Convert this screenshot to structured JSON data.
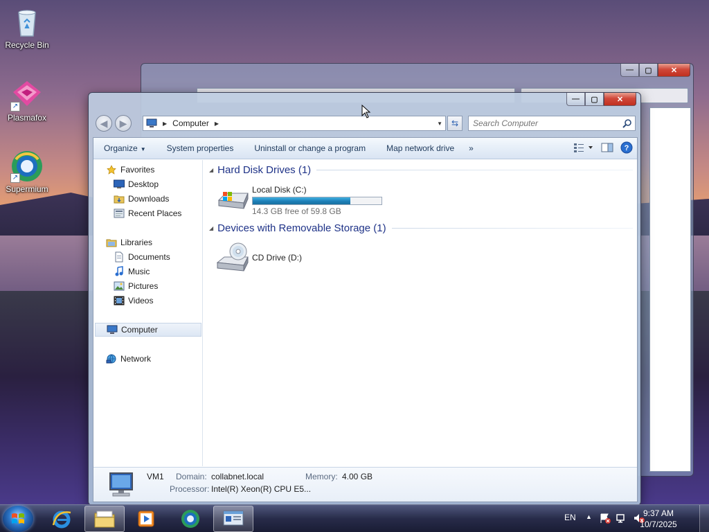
{
  "desktop": {
    "icons": [
      {
        "label": "Recycle Bin",
        "icon": "recycle-bin-icon"
      },
      {
        "label": "Plasmafox",
        "icon": "plasmafox-icon"
      },
      {
        "label": "Supermium",
        "icon": "supermium-icon"
      }
    ]
  },
  "window": {
    "address": {
      "location": "Computer"
    },
    "search": {
      "placeholder": "Search Computer"
    },
    "toolbar": {
      "organize": "Organize",
      "system_properties": "System properties",
      "uninstall": "Uninstall or change a program",
      "map_drive": "Map network drive",
      "more": "»"
    },
    "nav": {
      "favorites": {
        "label": "Favorites",
        "items": [
          "Desktop",
          "Downloads",
          "Recent Places"
        ]
      },
      "libraries": {
        "label": "Libraries",
        "items": [
          "Documents",
          "Music",
          "Pictures",
          "Videos"
        ]
      },
      "computer": "Computer",
      "network": "Network"
    },
    "groups": [
      {
        "title": "Hard Disk Drives (1)"
      },
      {
        "title": "Devices with Removable Storage (1)"
      }
    ],
    "drives": {
      "local_disk": {
        "name": "Local Disk (C:)",
        "free_text": "14.3 GB free of 59.8 GB",
        "used_fraction": 0.76
      },
      "cd_drive": {
        "name": "CD Drive (D:)"
      }
    },
    "details": {
      "name": "VM1",
      "domain_label": "Domain:",
      "domain_value": "collabnet.local",
      "memory_label": "Memory:",
      "memory_value": "4.00 GB",
      "processor_label": "Processor:",
      "processor_value": "Intel(R) Xeon(R) CPU E5..."
    }
  },
  "taskbar": {
    "lang": "EN",
    "time": "9:37 AM",
    "date": "10/7/2025",
    "accent": "#2d77c9"
  }
}
